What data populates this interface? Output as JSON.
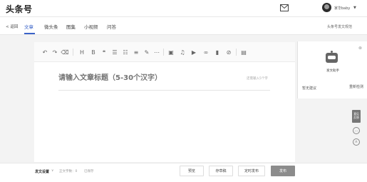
{
  "header": {
    "logo": "头条号",
    "username": "家华baby",
    "mail_icon": "mail-icon",
    "caret_icon": "caret-down-icon"
  },
  "nav": {
    "back_label": "< 返回",
    "tabs": [
      {
        "label": "文章",
        "active": true
      },
      {
        "label": "微头条",
        "active": false
      },
      {
        "label": "图集",
        "active": false
      },
      {
        "label": "小视频",
        "active": false
      },
      {
        "label": "问答",
        "active": false
      }
    ],
    "right_link": "头条号发文规范",
    "active_color": "#3a63c8"
  },
  "toolbar": {
    "items": [
      {
        "name": "undo-icon",
        "glyph": "↶"
      },
      {
        "name": "redo-icon",
        "glyph": "↷"
      },
      {
        "name": "clear-format-icon",
        "glyph": "⌫"
      },
      {
        "name": "heading-icon",
        "glyph": "H"
      },
      {
        "name": "bold-icon",
        "glyph": "B"
      },
      {
        "name": "quote-icon",
        "glyph": "❝"
      },
      {
        "name": "unordered-list-icon",
        "glyph": "☰"
      },
      {
        "name": "ordered-list-icon",
        "glyph": "☷"
      },
      {
        "name": "align-icon",
        "glyph": "≡"
      },
      {
        "name": "brush-icon",
        "glyph": "✎"
      },
      {
        "name": "divider-icon",
        "glyph": "⋯"
      },
      {
        "name": "image-icon",
        "glyph": "▣"
      },
      {
        "name": "music-icon",
        "glyph": "♫"
      },
      {
        "name": "video-icon",
        "glyph": "▶"
      },
      {
        "name": "link-icon",
        "glyph": "∞"
      },
      {
        "name": "poll-icon",
        "glyph": "▮"
      },
      {
        "name": "attachment-icon",
        "glyph": "⊘"
      },
      {
        "name": "document-icon",
        "glyph": "▤"
      }
    ]
  },
  "editor": {
    "title_placeholder": "请输入文章标题（5-30个汉字）",
    "title_hint": "还需输入5个字"
  },
  "assistant": {
    "title": "发文助手",
    "no_suggestion": "暂无建议",
    "recheck": "重新检测",
    "close_icon": "close-icon"
  },
  "side_tools": {
    "feedback_label": "意见\n反馈",
    "icons": [
      "chat-icon",
      "headset-icon"
    ]
  },
  "footer": {
    "settings_label": "发文设置",
    "word_count": "正文字数：0",
    "saved_status": "已保存",
    "preview_button": "预览",
    "save_draft_button": "存草稿",
    "schedule_button": "定时发布",
    "publish_button": "发布"
  }
}
